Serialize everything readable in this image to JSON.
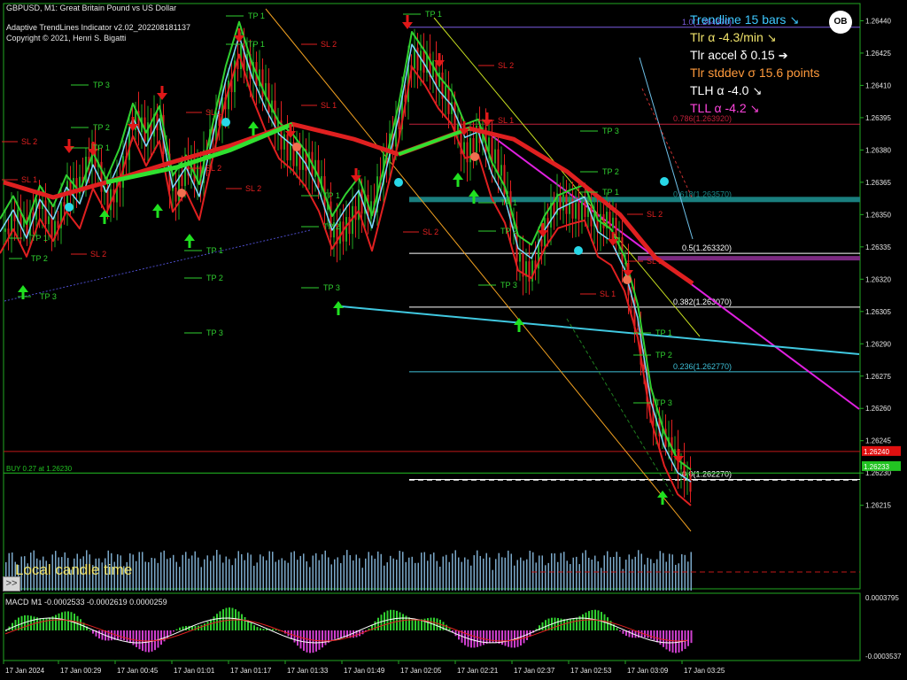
{
  "header": {
    "symbol_line": "GBPUSD, M1:  Great Britain Pound vs US Dollar",
    "indicator_line": "Adaptive TrendLines Indicator v2.02_202208181137",
    "copyright_line": "Copyright © 2021, Henri S. Bigatti"
  },
  "info_panel": {
    "lines": [
      {
        "text": "Trendline 15 bars",
        "icon": "arrow-down-right-icon",
        "color": "#3ec8ff"
      },
      {
        "text": "Tlr α -4.3/min",
        "icon": "arrow-down-right-icon",
        "color": "#f0e36b"
      },
      {
        "text": "Tlr accel δ 0.15",
        "icon": "arrow-right-icon",
        "color": "#ffffff"
      },
      {
        "text": "Tlr stddev σ 15.6 points",
        "icon": "",
        "color": "#ff9a3c"
      },
      {
        "text": "TLH α -4.0",
        "icon": "arrow-down-right-icon",
        "color": "#ffffff"
      },
      {
        "text": "TLL α -4.2",
        "icon": "arrow-down-right-icon",
        "color": "#ff44dd"
      }
    ],
    "logo_text": "OB"
  },
  "chart_data": {
    "type": "candlestick",
    "symbol": "GBPUSD",
    "timeframe": "M1",
    "ylim": [
      1.26205,
      1.26448
    ],
    "y_ticks": [
      "1.26440",
      "1.26425",
      "1.26410",
      "1.26395",
      "1.26380",
      "1.26365",
      "1.26350",
      "1.26335",
      "1.26320",
      "1.26305",
      "1.26290",
      "1.26275",
      "1.26260",
      "1.26245",
      "1.26230",
      "1.26215"
    ],
    "x_ticks": [
      "17 Jan 2024",
      "17 Jan 00:29",
      "17 Jan 00:45",
      "17 Jan 01:01",
      "17 Jan 01:17",
      "17 Jan 01:33",
      "17 Jan 01:49",
      "17 Jan 02:05",
      "17 Jan 02:21",
      "17 Jan 02:37",
      "17 Jan 02:53",
      "17 Jan 03:09",
      "17 Jan 03:25"
    ],
    "price_path": [
      [
        0,
        1.26342
      ],
      [
        15,
        1.2635
      ],
      [
        30,
        1.26336
      ],
      [
        45,
        1.26355
      ],
      [
        60,
        1.26348
      ],
      [
        75,
        1.26365
      ],
      [
        90,
        1.26358
      ],
      [
        105,
        1.26375
      ],
      [
        120,
        1.2636
      ],
      [
        135,
        1.26372
      ],
      [
        150,
        1.26392
      ],
      [
        165,
        1.2638
      ],
      [
        180,
        1.26395
      ],
      [
        195,
        1.26365
      ],
      [
        210,
        1.26375
      ],
      [
        225,
        1.2636
      ],
      [
        240,
        1.26385
      ],
      [
        255,
        1.2641
      ],
      [
        270,
        1.2643
      ],
      [
        285,
        1.26412
      ],
      [
        300,
        1.264
      ],
      [
        315,
        1.2639
      ],
      [
        330,
        1.26385
      ],
      [
        345,
        1.26375
      ],
      [
        360,
        1.2636
      ],
      [
        375,
        1.2634
      ],
      [
        390,
        1.2635
      ],
      [
        405,
        1.2636
      ],
      [
        420,
        1.26345
      ],
      [
        435,
        1.26372
      ],
      [
        450,
        1.26398
      ],
      [
        465,
        1.2643
      ],
      [
        480,
        1.26418
      ],
      [
        495,
        1.26405
      ],
      [
        510,
        1.26398
      ],
      [
        525,
        1.26385
      ],
      [
        540,
        1.2639
      ],
      [
        555,
        1.26372
      ],
      [
        570,
        1.2636
      ],
      [
        585,
        1.26335
      ],
      [
        600,
        1.26328
      ],
      [
        615,
        1.2634
      ],
      [
        630,
        1.2635
      ],
      [
        645,
        1.26355
      ],
      [
        660,
        1.2636
      ],
      [
        675,
        1.26345
      ],
      [
        690,
        1.2634
      ],
      [
        705,
        1.26325
      ],
      [
        720,
        1.263
      ],
      [
        735,
        1.2626
      ],
      [
        750,
        1.2624
      ],
      [
        765,
        1.2623
      ],
      [
        780,
        1.26228
      ]
    ],
    "fib_levels": [
      {
        "label": "1.0(1.264370)",
        "price": 1.26437,
        "color": "#7b5ce0"
      },
      {
        "label": "0.786(1.263920)",
        "price": 1.26392,
        "color": "#c0203a"
      },
      {
        "label": "0.618(1.263570)",
        "price": 1.26357,
        "color": "#1a8a8a"
      },
      {
        "label": "0.5(1.263320)",
        "price": 1.26332,
        "color": "#ffffff"
      },
      {
        "label": "0.382(1.263070)",
        "price": 1.26307,
        "color": "#ffffff"
      },
      {
        "label": "0.236(1.262770)",
        "price": 1.26277,
        "color": "#3fc1d9"
      },
      {
        "label": "0.0(1.262270)",
        "price": 1.26227,
        "color": "#ffffff"
      }
    ],
    "buy_line": {
      "label": "BUY 0.27 at 1.26230",
      "price": 1.2623
    },
    "price_tags": [
      {
        "text": "1.26240",
        "price": 1.2624,
        "bg": "#e01010"
      },
      {
        "text": "1.26233",
        "price": 1.26233,
        "bg": "#22c322"
      }
    ],
    "tp_labels": [
      "TP 1",
      "TP 2",
      "TP 3"
    ],
    "sl_labels": [
      "SL 1",
      "SL 2"
    ],
    "sub_panel": {
      "label": "MACD M1 -0.0002533 -0.0002619 0.0000259",
      "y_ticks": [
        "0.0003795",
        "-0.0003537"
      ]
    },
    "local_time_label": "Local candle time",
    "expand_label": ">>"
  }
}
